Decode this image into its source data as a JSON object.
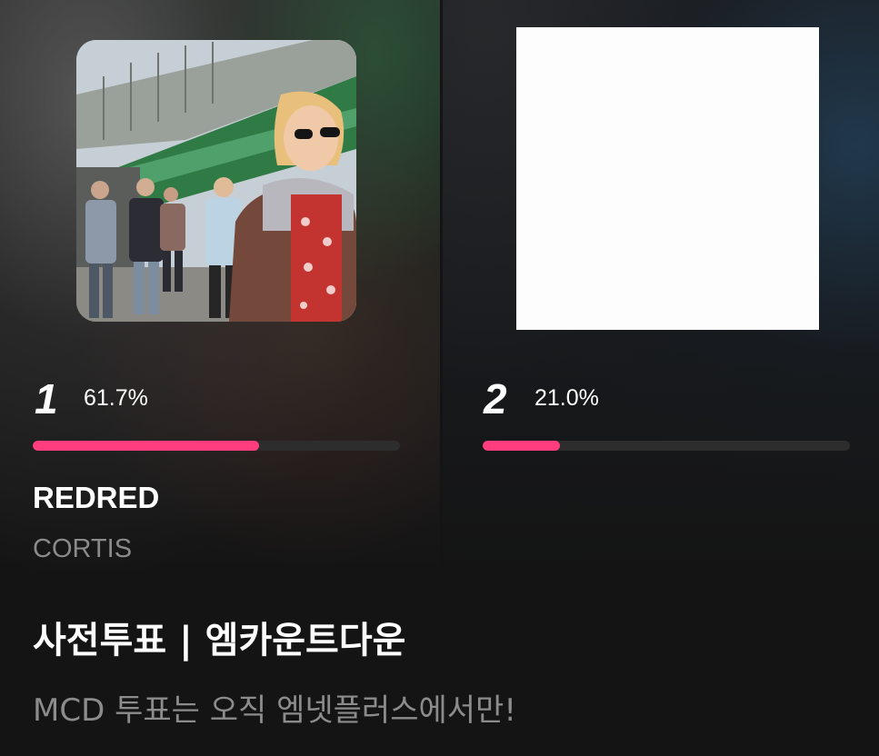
{
  "chart_entries": [
    {
      "rank": "1",
      "percent_label": "61.7%",
      "percent": 61.7,
      "title": "REDRED",
      "artist": "CORTIS"
    },
    {
      "rank": "2",
      "percent_label": "21.0%",
      "percent": 21.0
    }
  ],
  "section": {
    "title": "사전투표 | 엠카운트다운",
    "subtitle": "MCD 투표는 오직 엠넷플러스에서만!"
  },
  "colors": {
    "accent": "#ff3d7f",
    "bar_track": "#2d2d2d",
    "background": "#141414",
    "muted_text": "#8a8a8a"
  }
}
